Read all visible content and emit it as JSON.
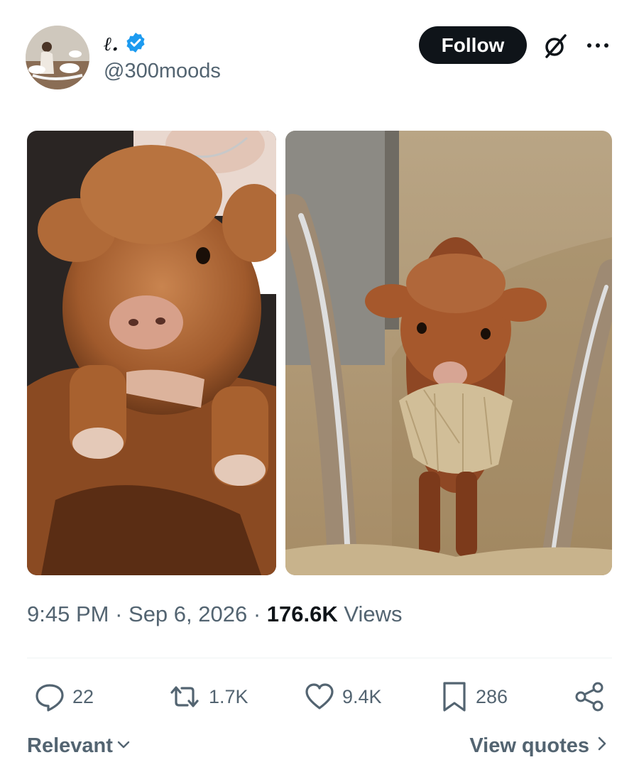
{
  "author": {
    "display_name": "ℓ.",
    "handle": "@300moods",
    "verified": true
  },
  "header": {
    "follow_label": "Follow",
    "icons": [
      "grok-icon",
      "more-icon"
    ]
  },
  "media": [
    {
      "name": "highland-calf-held-photo"
    },
    {
      "name": "highland-calf-hay-photo"
    }
  ],
  "meta": {
    "time": "9:45 PM",
    "date": "Sep 6, 2026",
    "views_count": "176.6K",
    "views_label": "Views"
  },
  "actions": {
    "replies": "22",
    "reposts": "1.7K",
    "likes": "9.4K",
    "bookmarks": "286"
  },
  "footer": {
    "sort_label": "Relevant",
    "quotes_label": "View quotes"
  },
  "colors": {
    "text_primary": "#0f1419",
    "text_secondary": "#536471",
    "verified_blue": "#1d9bf0",
    "follow_bg": "#0f1419"
  }
}
